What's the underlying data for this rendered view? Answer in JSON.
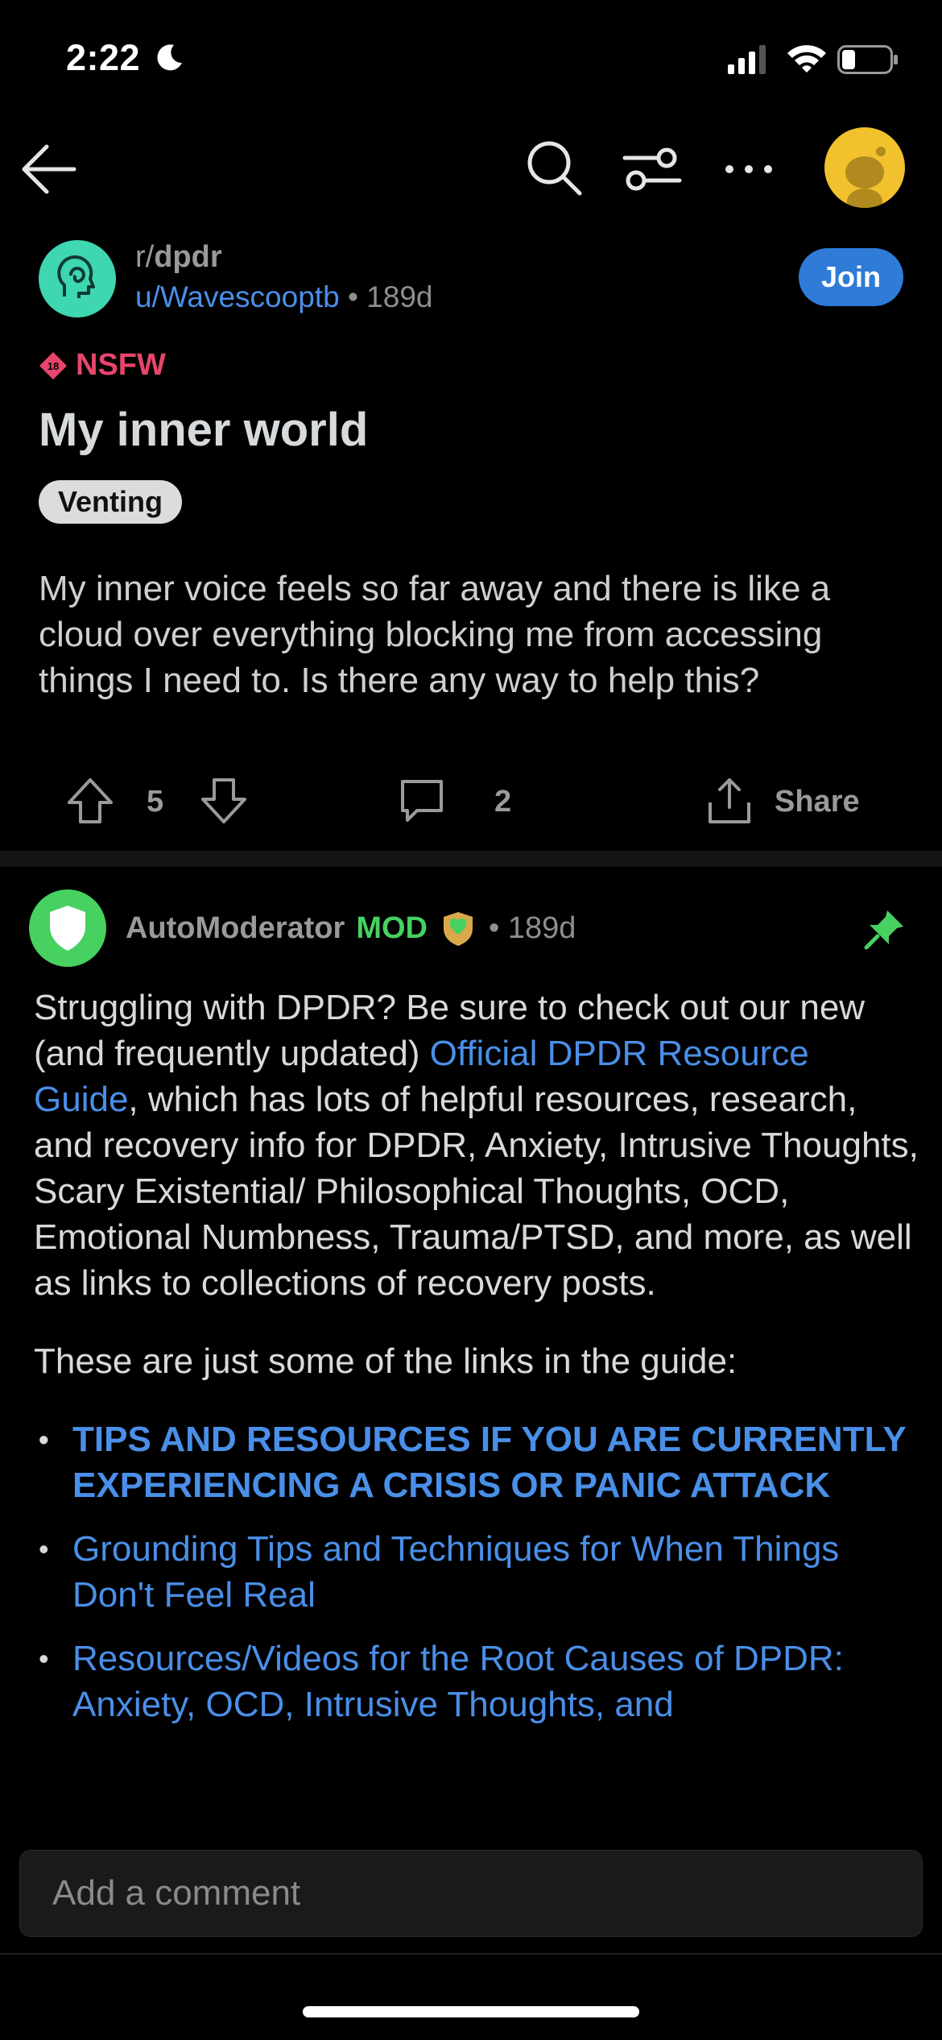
{
  "status": {
    "time": "2:22"
  },
  "post": {
    "subreddit_prefix": "r/",
    "subreddit": "dpdr",
    "author": "u/Wavescooptb",
    "age": "• 189d",
    "join_label": "Join",
    "nsfw_label": "NSFW",
    "title": "My inner world",
    "flair": "Venting",
    "body": "My inner voice feels so far away and there is like a cloud over everything blocking me from accessing things I need to. Is there any way to help this?",
    "upvotes": "5",
    "comments": "2",
    "share_label": "Share"
  },
  "comment": {
    "user": "AutoModerator",
    "mod_label": "MOD",
    "age": "• 189d",
    "p1_a": "Struggling with DPDR? Be sure to check out our new (and frequently updated) ",
    "p1_link": "Official DPDR Resource Guide",
    "p1_b": ", which has lots of helpful resources, research, and recovery info for DPDR, Anxiety, Intrusive Thoughts, Scary Existential/ Philosophical Thoughts, OCD, Emotional Numbness, Trauma/PTSD, and more, as well as links to collections of recovery posts.",
    "p2": "These are just some of the links in the guide:",
    "links": [
      "TIPS AND RESOURCES IF YOU ARE CURRENTLY EXPERIENCING A CRISIS OR PANIC ATTACK",
      "Grounding Tips and Techniques for When Things Don't Feel Real",
      "Resources/Videos for the Root Causes of DPDR: Anxiety, OCD, Intrusive Thoughts, and"
    ]
  },
  "composer": {
    "placeholder": "Add a comment"
  },
  "colors": {
    "link": "#4a8fe8",
    "join": "#2e7bd8",
    "nsfw": "#e8456c",
    "mod": "#46d160"
  }
}
